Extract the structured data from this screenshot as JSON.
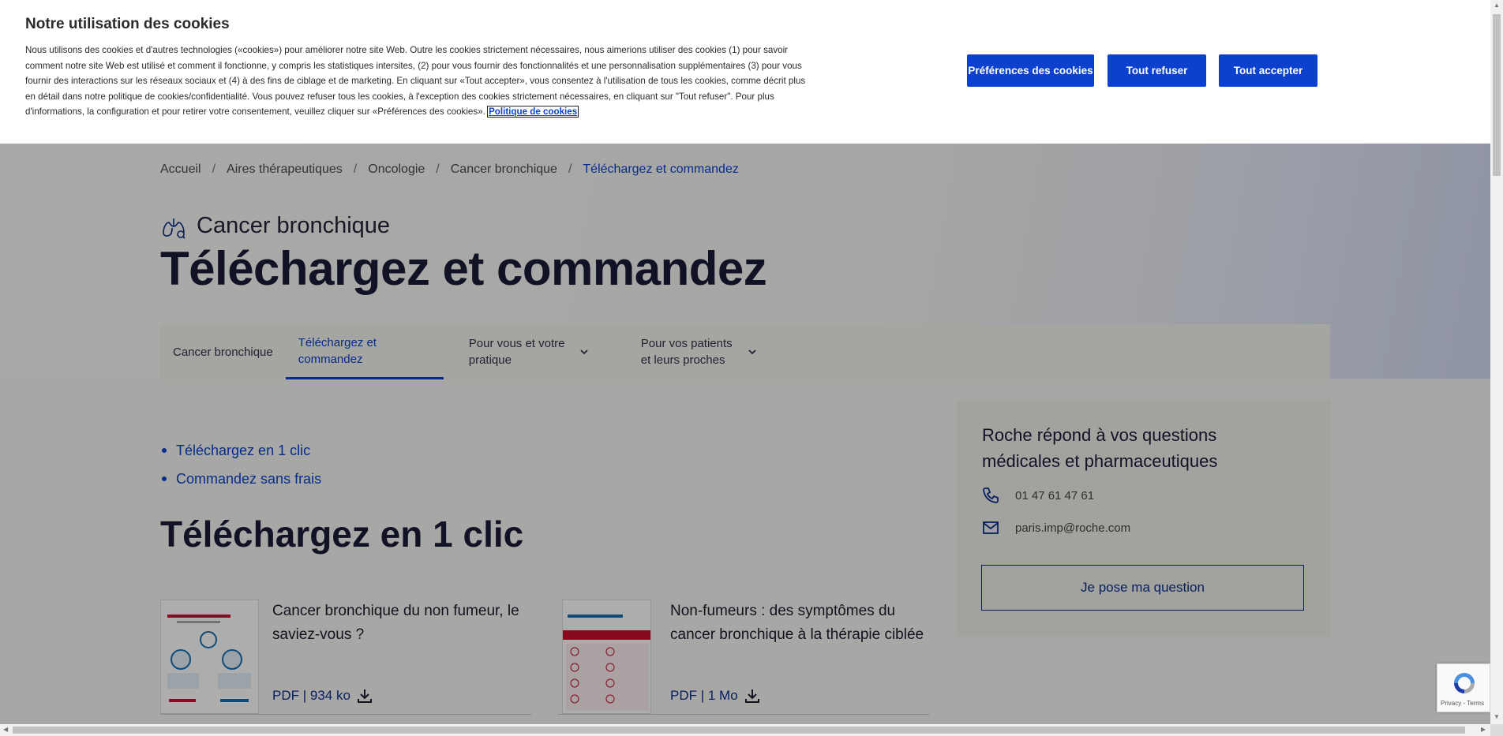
{
  "cookie_banner": {
    "title": "Notre utilisation des cookies",
    "text": "Nous utilisons des cookies et d'autres technologies («cookies») pour améliorer notre site Web. Outre les cookies strictement nécessaires, nous aimerions utiliser des cookies (1) pour savoir comment notre site Web est utilisé et comment il fonctionne, y compris les statistiques intersites, (2) pour vous fournir des fonctionnalités et une personnalisation supplémentaires (3) pour vous fournir des interactions sur les réseaux sociaux et (4) à des fins de ciblage et de marketing. En cliquant sur «Tout accepter», vous consentez à l'utilisation de tous les cookies, comme décrit plus en détail dans notre politique de cookies/confidentialité. Vous pouvez refuser tous les cookies, à l'exception des cookies strictement nécessaires, en cliquant sur \"Tout refuser\". Pour plus d'informations, la configuration et pour retirer votre consentement, veuillez cliquer sur «Préférences des cookies». ",
    "policy_link": "Politique de cookies",
    "buttons": {
      "preferences": "Préférences des cookies",
      "reject": "Tout refuser",
      "accept": "Tout accepter"
    }
  },
  "breadcrumb": {
    "items": [
      "Accueil",
      "Aires thérapeutiques",
      "Oncologie",
      "Cancer bronchique"
    ],
    "current": "Téléchargez et commandez",
    "separator": "/"
  },
  "header": {
    "subtitle": "Cancer bronchique",
    "title": "Téléchargez et commandez"
  },
  "tabs": [
    {
      "line1": "Cancer bronchique",
      "line2": ""
    },
    {
      "line1": "Téléchargez et",
      "line2": "commandez"
    },
    {
      "line1": "Pour vous et votre",
      "line2": "pratique"
    },
    {
      "line1": "Pour vos patients",
      "line2": "et leurs proches"
    }
  ],
  "anchors": [
    "Téléchargez en 1 clic",
    "Commandez sans frais"
  ],
  "section_title": "Téléchargez en 1 clic",
  "documents": [
    {
      "title": "Cancer bronchique du non fumeur, le saviez-vous ?",
      "meta": "PDF | 934 ko"
    },
    {
      "title": "Non-fumeurs : des symptômes du cancer bronchique à la thérapie ciblée",
      "meta": "PDF | 1 Mo"
    }
  ],
  "aside": {
    "title": "Roche répond à vos questions médicales et pharmaceutiques",
    "phone": "01 47 61 47 61",
    "email": "paris.imp@roche.com",
    "button": "Je pose ma question"
  },
  "recaptcha": {
    "text": "Privacy - Terms"
  },
  "colors": {
    "accent": "#0b41cd",
    "dark_blue": "#0b2f8a",
    "banner_bg": "#ffffff"
  }
}
